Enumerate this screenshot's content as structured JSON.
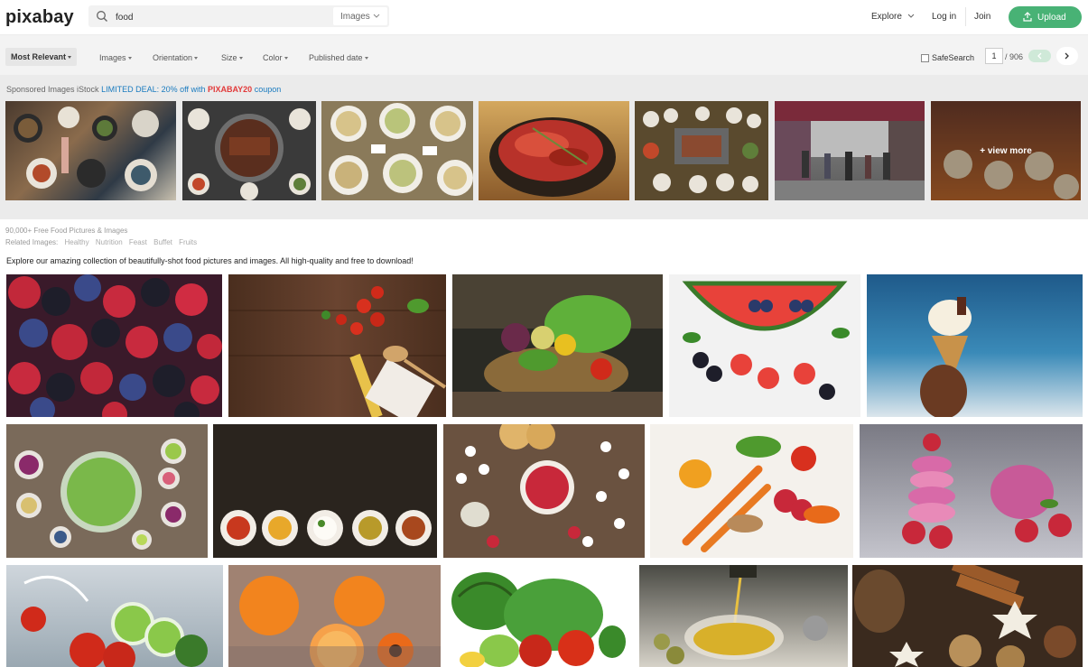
{
  "header": {
    "logo": "pixabay",
    "search_value": "food",
    "search_type": "Images",
    "explore": "Explore",
    "login": "Log in",
    "join": "Join",
    "upload": "Upload"
  },
  "filters": {
    "sort": "Most Relevant",
    "type": "Images",
    "orientation": "Orientation",
    "size": "Size",
    "color": "Color",
    "published": "Published date",
    "safesearch": "SafeSearch",
    "page": "1",
    "page_total": "/ 906"
  },
  "sponsored": {
    "prefix": "Sponsored Images iStock",
    "deal": "LIMITED DEAL: 20% off with",
    "code": "PIXABAY20",
    "suffix": "coupon",
    "view_more": "+ view more"
  },
  "info": {
    "count": "90,000+ Free Food Pictures & Images",
    "related_label": "Related Images:",
    "related": [
      "Healthy",
      "Nutrition",
      "Feast",
      "Buffet",
      "Fruits"
    ],
    "description": "Explore our amazing collection of beautifully-shot food pictures and images. All high-quality and free to download!"
  },
  "colors": {
    "accent": "#48b275",
    "deal": "#1a7bbf",
    "code": "#e23a3a"
  },
  "images": {
    "sponsored": [
      "korean-table-spread",
      "korean-bbq-grill",
      "noodle-bowls",
      "kimchi-bowl",
      "bbq-table-overhead",
      "busy-market-street",
      "market-stall-food"
    ],
    "row1": [
      "berries-mix",
      "tomatoes-pasta-wood",
      "vegetable-basket",
      "watermelon-hearts",
      "ice-cream-cone"
    ],
    "row2": [
      "salad-bowls-table",
      "spice-bowls-dark",
      "raspberries-daisies",
      "carrots-peppers",
      "pink-macarons"
    ],
    "row3": [
      "vegetable-splash",
      "oranges-gerbera",
      "watermelon-veggies",
      "olive-oil-pour",
      "christmas-spices"
    ]
  }
}
